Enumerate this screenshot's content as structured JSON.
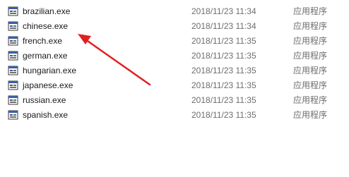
{
  "files": [
    {
      "name": "brazilian.exe",
      "modified": "2018/11/23 11:34",
      "type": "应用程序",
      "icon": "exe-file-icon"
    },
    {
      "name": "chinese.exe",
      "modified": "2018/11/23 11:34",
      "type": "应用程序",
      "icon": "exe-file-icon"
    },
    {
      "name": "french.exe",
      "modified": "2018/11/23 11:35",
      "type": "应用程序",
      "icon": "exe-file-icon"
    },
    {
      "name": "german.exe",
      "modified": "2018/11/23 11:35",
      "type": "应用程序",
      "icon": "exe-file-icon"
    },
    {
      "name": "hungarian.exe",
      "modified": "2018/11/23 11:35",
      "type": "应用程序",
      "icon": "exe-file-icon"
    },
    {
      "name": "japanese.exe",
      "modified": "2018/11/23 11:35",
      "type": "应用程序",
      "icon": "exe-file-icon"
    },
    {
      "name": "russian.exe",
      "modified": "2018/11/23 11:35",
      "type": "应用程序",
      "icon": "exe-file-icon"
    },
    {
      "name": "spanish.exe",
      "modified": "2018/11/23 11:35",
      "type": "应用程序",
      "icon": "exe-file-icon"
    }
  ],
  "annotation": {
    "color": "#e02020",
    "points_to": "chinese.exe"
  }
}
